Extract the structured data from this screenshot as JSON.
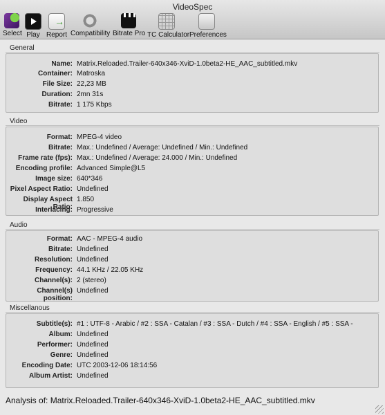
{
  "window": {
    "title": "VideoSpec"
  },
  "toolbar": {
    "items": [
      {
        "label": "Select",
        "icon": "select-icon"
      },
      {
        "label": "Play",
        "icon": "play-icon"
      },
      {
        "label": "Report",
        "icon": "report-icon"
      },
      {
        "label": "Compatibility",
        "icon": "compatibility-icon"
      },
      {
        "label": "Bitrate Pro",
        "icon": "clapperboard-icon"
      },
      {
        "label": "TC Calculator",
        "icon": "calculator-icon"
      },
      {
        "label": "Preferences",
        "icon": "preferences-icon"
      }
    ]
  },
  "general": {
    "title": "General",
    "rows": [
      {
        "key": "Name:",
        "value": "Matrix.Reloaded.Trailer-640x346-XviD-1.0beta2-HE_AAC_subtitled.mkv"
      },
      {
        "key": "Container:",
        "value": "Matroska"
      },
      {
        "key": "File Size:",
        "value": "22,23 MB"
      },
      {
        "key": "Duration:",
        "value": "2mn 31s"
      },
      {
        "key": "Bitrate:",
        "value": "1 175 Kbps"
      }
    ]
  },
  "video": {
    "title": "Video",
    "rows": [
      {
        "key": "Format:",
        "value": "MPEG-4 video"
      },
      {
        "key": "Bitrate:",
        "value": "Max.: Undefined / Average: Undefined / Min.: Undefined"
      },
      {
        "key": "Frame rate (fps):",
        "value": "Max.: Undefined / Average: 24.000 / Min.: Undefined"
      },
      {
        "key": "Encoding profile:",
        "value": "Advanced Simple@L5"
      },
      {
        "key": "Image size:",
        "value": "640*346"
      },
      {
        "key": "Pixel Aspect Ratio:",
        "value": "Undefined"
      },
      {
        "key": "Display Aspect Ratio:",
        "value": "1.850"
      },
      {
        "key": "Interlacing:",
        "value": "Progressive"
      }
    ]
  },
  "audio": {
    "title": "Audio",
    "rows": [
      {
        "key": "Format:",
        "value": "AAC - MPEG-4 audio"
      },
      {
        "key": "Bitrate:",
        "value": "Undefined"
      },
      {
        "key": "Resolution:",
        "value": "Undefined"
      },
      {
        "key": "Frequency:",
        "value": "44.1 KHz / 22.05 KHz"
      },
      {
        "key": "Channel(s):",
        "value": "2 (stereo)"
      },
      {
        "key": "Channel(s) position:",
        "value": "Undefined"
      }
    ]
  },
  "misc": {
    "title": "Miscellanous",
    "rows": [
      {
        "key": "Subtitle(s):",
        "value": "#1 : UTF-8 - Arabic / #2 : SSA - Catalan / #3 : SSA - Dutch / #4 : SSA - English / #5 : SSA -"
      },
      {
        "key": "Album:",
        "value": "Undefined"
      },
      {
        "key": "Performer:",
        "value": "Undefined"
      },
      {
        "key": "Genre:",
        "value": "Undefined"
      },
      {
        "key": "Encoding Date:",
        "value": "UTC 2003-12-06 18:14:56"
      },
      {
        "key": "Album Artist:",
        "value": "Undefined"
      }
    ]
  },
  "status": {
    "text": "Analysis of:  Matrix.Reloaded.Trailer-640x346-XviD-1.0beta2-HE_AAC_subtitled.mkv"
  }
}
